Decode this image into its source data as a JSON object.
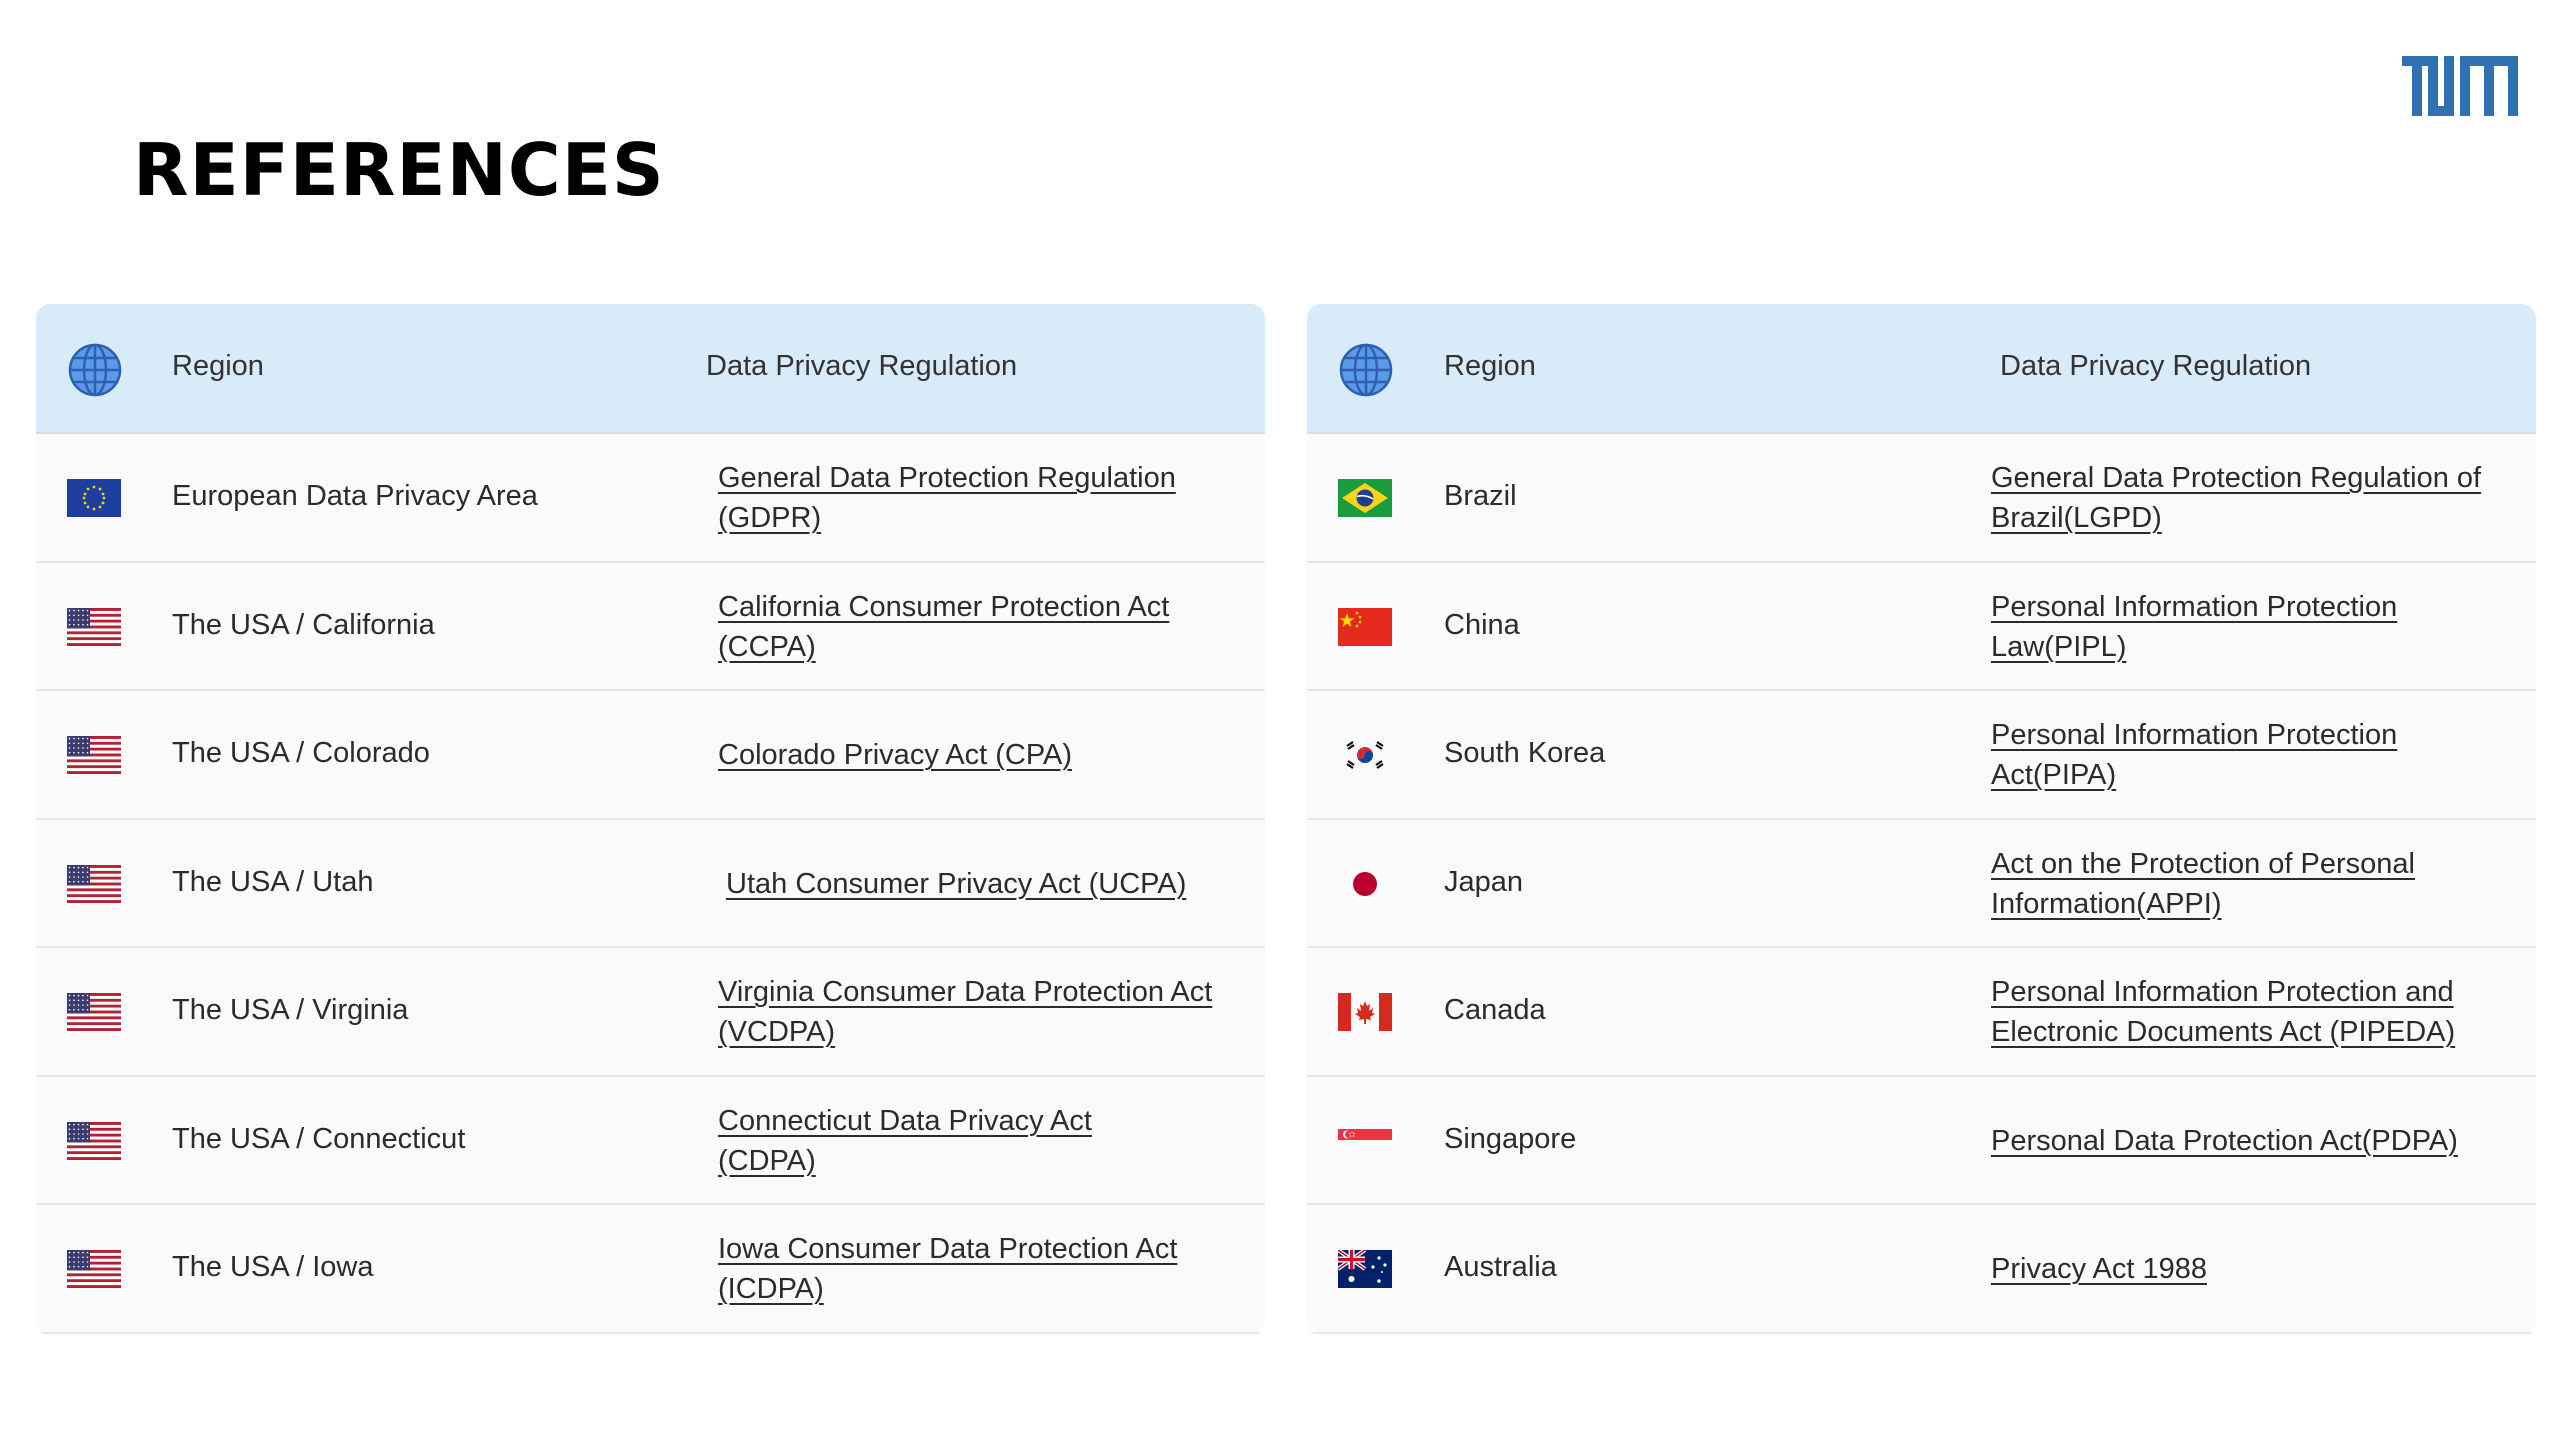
{
  "page": {
    "title": "REFERENCES"
  },
  "colors": {
    "header_bg": "#d8ebf9",
    "row_bg": "#fafafa",
    "logo": "#3070b3"
  },
  "logo": {
    "label": "TUM",
    "icon": "tum-logo"
  },
  "tables": [
    {
      "header": {
        "icon": "globe-icon",
        "region": "Region",
        "regulation": "Data Privacy Regulation"
      },
      "rows": [
        {
          "flag": "eu-flag",
          "region": "European Data Privacy Area",
          "regulation": "General Data Protection Regulation (GDPR)"
        },
        {
          "flag": "us-flag",
          "region": "The USA / California",
          "regulation": "California Consumer Protection Act (CCPA)"
        },
        {
          "flag": "us-flag",
          "region": "The USA / Colorado",
          "regulation": "Colorado Privacy Act (CPA)"
        },
        {
          "flag": "us-flag",
          "region": "The USA / Utah",
          "regulation": "Utah Consumer Privacy Act (UCPA)"
        },
        {
          "flag": "us-flag",
          "region": "The USA / Virginia",
          "regulation": "Virginia Consumer Data Protection Act (VCDPA)"
        },
        {
          "flag": "us-flag",
          "region": "The USA / Connecticut",
          "regulation": "Connecticut Data Privacy Act (CDPA)"
        },
        {
          "flag": "us-flag",
          "region": "The USA / Iowa",
          "regulation": "Iowa Consumer Data Protection Act (ICDPA)"
        }
      ]
    },
    {
      "header": {
        "icon": "globe-icon",
        "region": "Region",
        "regulation": "Data Privacy Regulation"
      },
      "rows": [
        {
          "flag": "brazil-flag",
          "region": "Brazil",
          "regulation": "General Data Protection Regulation of Brazil(LGPD)"
        },
        {
          "flag": "china-flag",
          "region": "China",
          "regulation": "Personal Information Protection Law(PIPL)"
        },
        {
          "flag": "south-korea-flag",
          "region": "South Korea",
          "regulation": "Personal Information Protection Act(PIPA)"
        },
        {
          "flag": "japan-flag",
          "region": "Japan",
          "regulation": "Act on the Protection of Personal Information(APPI)"
        },
        {
          "flag": "canada-flag",
          "region": "Canada",
          "regulation": "Personal Information Protection and Electronic Documents Act (PIPEDA)"
        },
        {
          "flag": "singapore-flag",
          "region": "Singapore",
          "regulation": "Personal Data Protection Act(PDPA)"
        },
        {
          "flag": "australia-flag",
          "region": "Australia",
          "regulation": "Privacy Act 1988"
        }
      ]
    }
  ]
}
